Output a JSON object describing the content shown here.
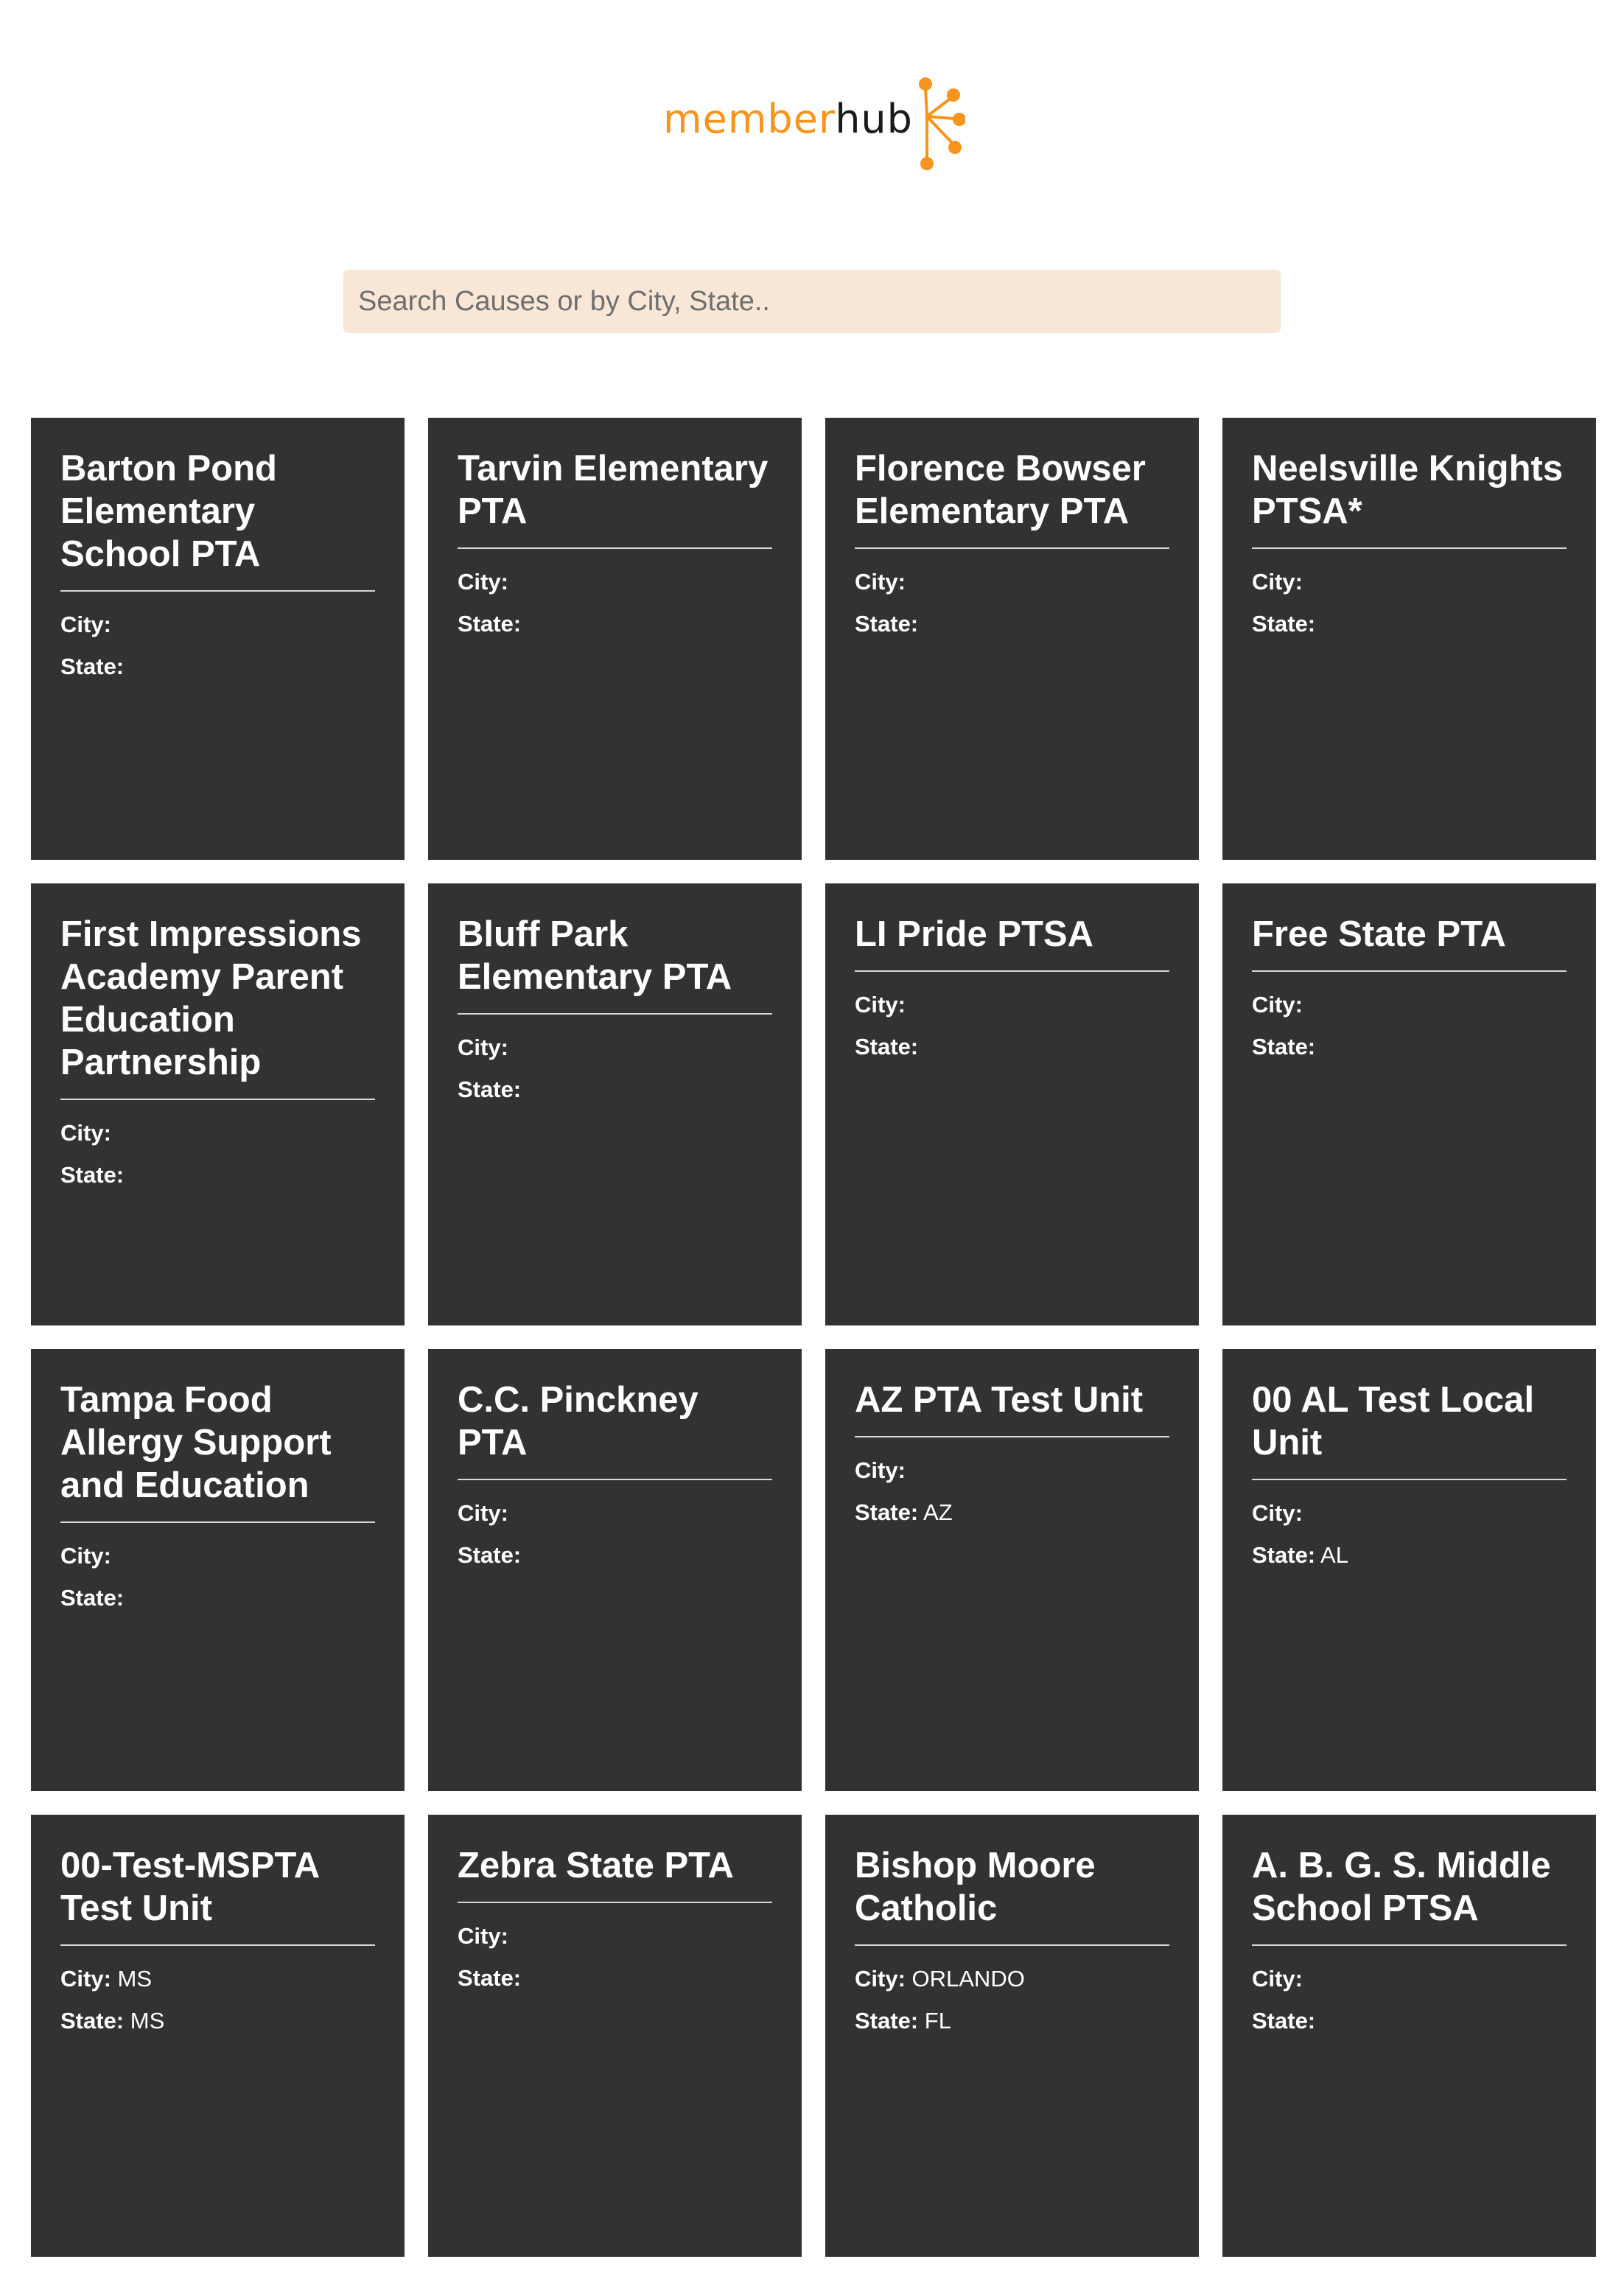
{
  "brand": {
    "logo_part1": "member",
    "logo_part2": "hub",
    "accent_color": "#f7941d",
    "dark_text_color": "#1a1a1a"
  },
  "search": {
    "placeholder": "Search Causes or by City, State..",
    "value": ""
  },
  "labels": {
    "city": "City:",
    "state": "State:"
  },
  "cards": [
    {
      "title": "Barton Pond Elementary School PTA",
      "city": "",
      "state": ""
    },
    {
      "title": "Tarvin Elementary PTA",
      "city": "",
      "state": ""
    },
    {
      "title": "Florence Bowser Elementary PTA",
      "city": "",
      "state": ""
    },
    {
      "title": "Neelsville Knights PTSA*",
      "city": "",
      "state": ""
    },
    {
      "title": "First Impressions Academy Parent Education Partnership",
      "city": "",
      "state": ""
    },
    {
      "title": "Bluff Park Elementary PTA",
      "city": "",
      "state": ""
    },
    {
      "title": "LI Pride PTSA",
      "city": "",
      "state": ""
    },
    {
      "title": "Free State PTA",
      "city": "",
      "state": ""
    },
    {
      "title": "Tampa Food Allergy Support and Education",
      "city": "",
      "state": ""
    },
    {
      "title": "C.C. Pinckney PTA",
      "city": "",
      "state": ""
    },
    {
      "title": "AZ PTA Test Unit",
      "city": "",
      "state": "AZ"
    },
    {
      "title": "00 AL Test Local Unit",
      "city": "",
      "state": "AL"
    },
    {
      "title": "00-Test-MSPTA Test Unit",
      "city": "MS",
      "state": "MS"
    },
    {
      "title": "Zebra State PTA",
      "city": "",
      "state": ""
    },
    {
      "title": "Bishop Moore Catholic",
      "city": "ORLANDO",
      "state": "FL"
    },
    {
      "title": "A. B. G. S. Middle School PTSA",
      "city": "",
      "state": ""
    }
  ]
}
